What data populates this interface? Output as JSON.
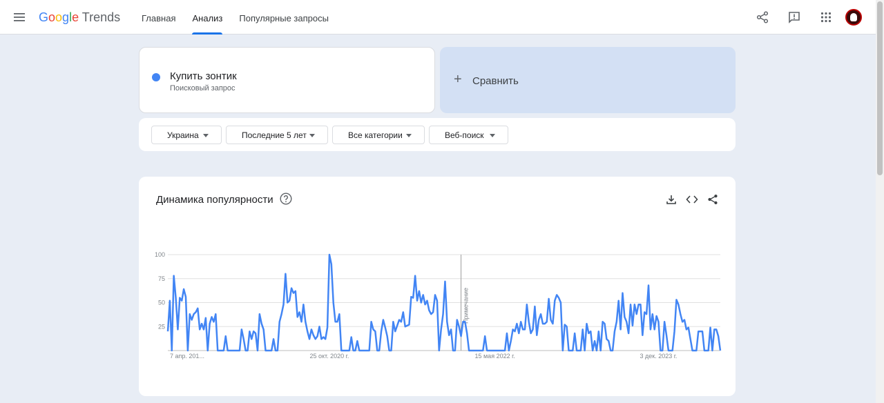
{
  "app": {
    "logo_google": "Google",
    "logo_trends": "Trends"
  },
  "nav": {
    "items": [
      {
        "label": "Главная",
        "active": false
      },
      {
        "label": "Анализ",
        "active": true
      },
      {
        "label": "Популярные запросы",
        "active": false
      }
    ]
  },
  "top_icons": [
    "share-icon",
    "feedback-icon",
    "apps-grid-icon",
    "avatar"
  ],
  "search_term": {
    "title": "Купить зонтик",
    "subtitle": "Поисковый запрос",
    "color": "#4285f4"
  },
  "compare": {
    "plus": "+",
    "label": "Сравнить"
  },
  "filters": [
    {
      "label": "Украина"
    },
    {
      "label": "Последние 5 лет"
    },
    {
      "label": "Все категории"
    },
    {
      "label": "Веб-поиск"
    }
  ],
  "card": {
    "title": "Динамика популярности",
    "tools": [
      "download-icon",
      "embed-icon",
      "share-icon"
    ]
  },
  "chart_data": {
    "type": "line",
    "title": "",
    "xlabel": "",
    "ylabel": "",
    "ylim": [
      0,
      100
    ],
    "yticks": [
      25,
      50,
      75,
      100
    ],
    "grid": true,
    "line_color": "#4285f4",
    "x_tick_labels": [
      {
        "label": "7 апр. 201...",
        "index": 0
      },
      {
        "label": "25 окт. 2020 г.",
        "index": 81
      },
      {
        "label": "15 мая 2022 г.",
        "index": 164
      },
      {
        "label": "3 дек. 2023 г.",
        "index": 246
      }
    ],
    "annotation": {
      "label": "Примечание",
      "index": 147
    },
    "series": [
      {
        "values": [
          20,
          52,
          0,
          78,
          55,
          22,
          55,
          52,
          64,
          56,
          0,
          38,
          32,
          38,
          40,
          44,
          22,
          28,
          22,
          34,
          0,
          28,
          35,
          30,
          38,
          0,
          0,
          0,
          0,
          15,
          0,
          0,
          0,
          0,
          0,
          0,
          0,
          22,
          12,
          0,
          0,
          20,
          12,
          20,
          18,
          0,
          38,
          28,
          22,
          0,
          0,
          0,
          0,
          12,
          0,
          0,
          30,
          38,
          48,
          80,
          50,
          52,
          65,
          60,
          62,
          35,
          40,
          30,
          48,
          30,
          20,
          12,
          22,
          16,
          12,
          15,
          25,
          12,
          14,
          12,
          24,
          100,
          90,
          50,
          30,
          30,
          38,
          0,
          0,
          0,
          0,
          0,
          14,
          0,
          0,
          10,
          0,
          0,
          0,
          0,
          0,
          0,
          30,
          22,
          20,
          0,
          0,
          20,
          32,
          24,
          15,
          0,
          0,
          30,
          20,
          26,
          32,
          30,
          40,
          25,
          26,
          27,
          56,
          55,
          78,
          52,
          62,
          50,
          58,
          48,
          52,
          42,
          38,
          40,
          58,
          52,
          0,
          22,
          38,
          72,
          30,
          16,
          22,
          0,
          0,
          32,
          25,
          15,
          30,
          30,
          18,
          0,
          0,
          0,
          0,
          0,
          0,
          0,
          0,
          15,
          0,
          0,
          0,
          0,
          0,
          0,
          0,
          0,
          0,
          0,
          18,
          0,
          10,
          22,
          20,
          28,
          18,
          30,
          22,
          22,
          48,
          30,
          18,
          22,
          46,
          16,
          32,
          38,
          28,
          28,
          30,
          54,
          32,
          28,
          52,
          58,
          55,
          50,
          0,
          27,
          25,
          0,
          0,
          0,
          18,
          0,
          0,
          0,
          22,
          0,
          28,
          18,
          20,
          0,
          10,
          0,
          20,
          0,
          30,
          28,
          12,
          10,
          0,
          0,
          20,
          30,
          52,
          22,
          60,
          35,
          30,
          18,
          48,
          26,
          48,
          38,
          48,
          48,
          16,
          40,
          38,
          68,
          22,
          38,
          22,
          36,
          30,
          0,
          0,
          30,
          16,
          0,
          0,
          0,
          20,
          53,
          48,
          38,
          30,
          32,
          22,
          24,
          12,
          0,
          0,
          0,
          20,
          20,
          20,
          0,
          0,
          0,
          24,
          0,
          22,
          22,
          15,
          0
        ]
      }
    ]
  }
}
